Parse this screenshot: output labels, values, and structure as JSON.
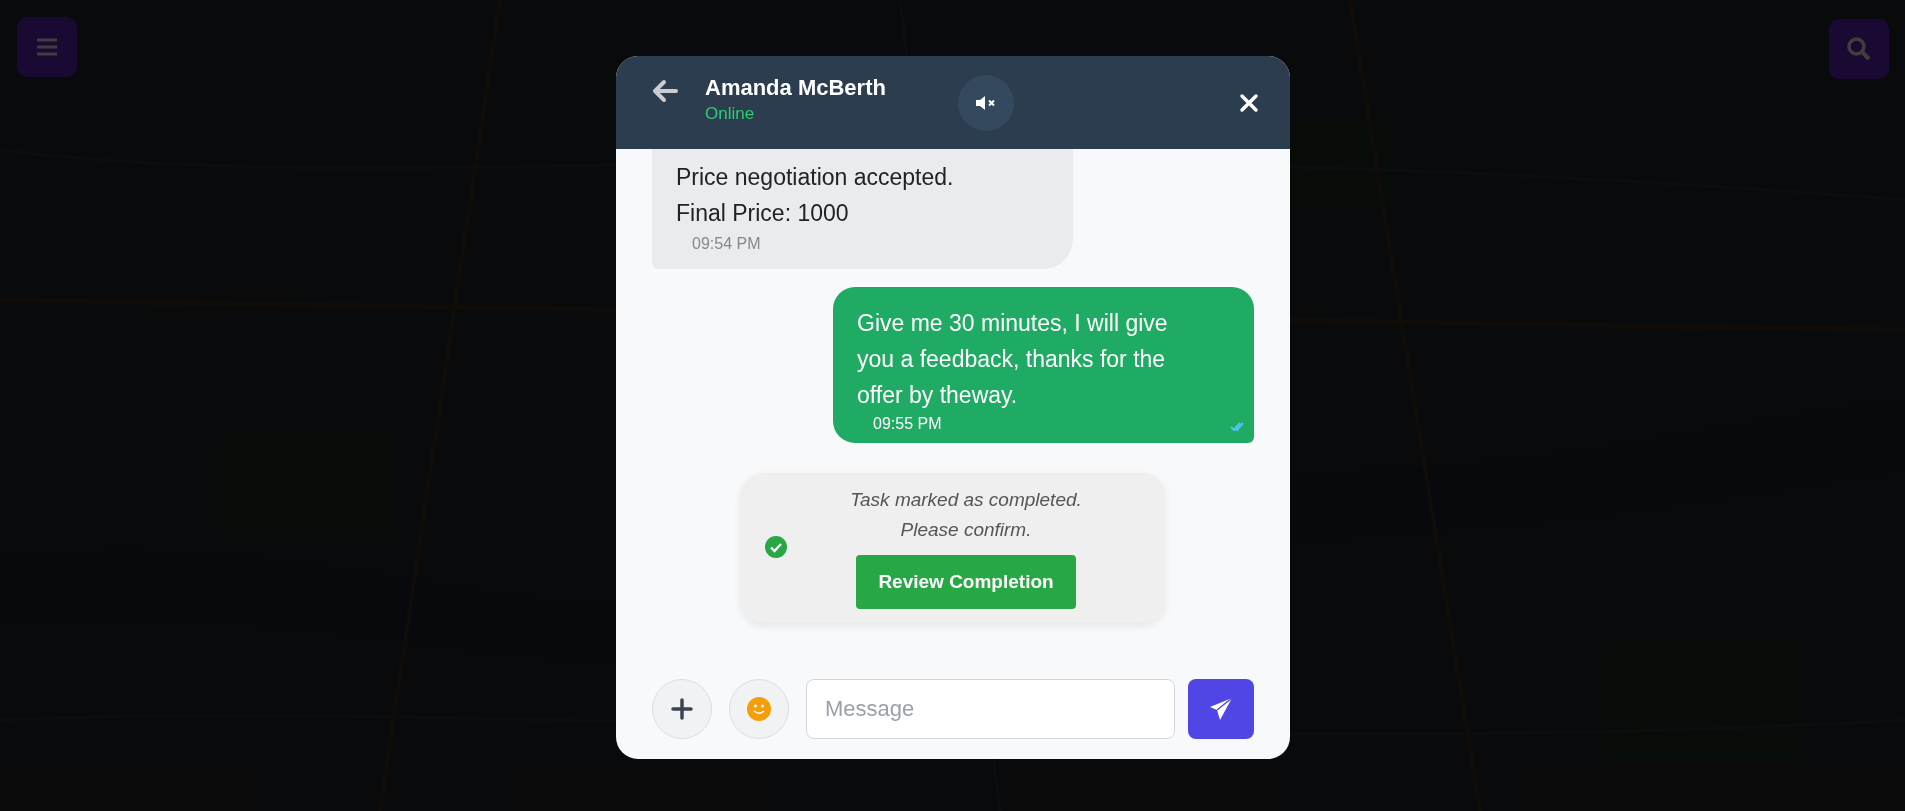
{
  "header": {
    "name": "Amanda McBerth",
    "status": "Online",
    "muted": true
  },
  "messages": [
    {
      "kind": "received",
      "lines": [
        "Price negotiation accepted.",
        "Final Price: 1000"
      ],
      "time": "09:54 PM"
    },
    {
      "kind": "sent",
      "lines": [
        "Give me 30 minutes, I will give you a feedback, thanks for the offer by theway."
      ],
      "time": "09:55 PM",
      "read": true
    },
    {
      "kind": "system",
      "lines": [
        "Task marked as completed.",
        "Please confirm."
      ],
      "action": "Review Completion"
    }
  ],
  "composer": {
    "placeholder": "Message"
  }
}
